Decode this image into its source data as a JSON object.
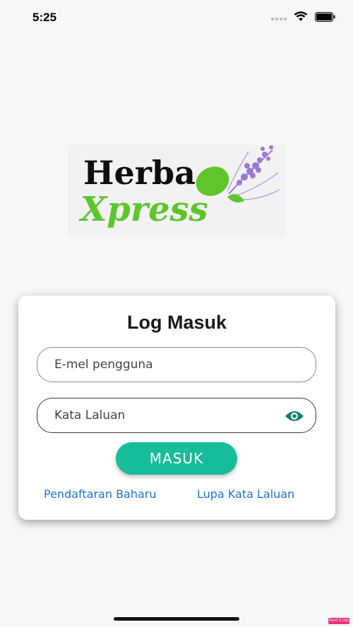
{
  "status_bar": {
    "time": "5:25",
    "icons": [
      "signal-icon",
      "wifi-icon",
      "battery-icon"
    ]
  },
  "logo": {
    "name": "HerbaXpress",
    "word1": "Herba",
    "word2": "Xpress",
    "colors": {
      "dark": "#0d0d0d",
      "green": "#5ec62b",
      "lavender": "#9a79d9"
    }
  },
  "login": {
    "title": "Log Masuk",
    "email_placeholder": "E-mel pengguna",
    "password_placeholder": "Kata Laluan",
    "submit_label": "MASUK",
    "register_link": "Pendaftaran Baharu",
    "forgot_link": "Lupa Kata Laluan"
  },
  "watermark": "Paint X Lite",
  "colors": {
    "accent": "#17bd99",
    "link": "#1e73d2",
    "background": "#f7f7f7"
  }
}
